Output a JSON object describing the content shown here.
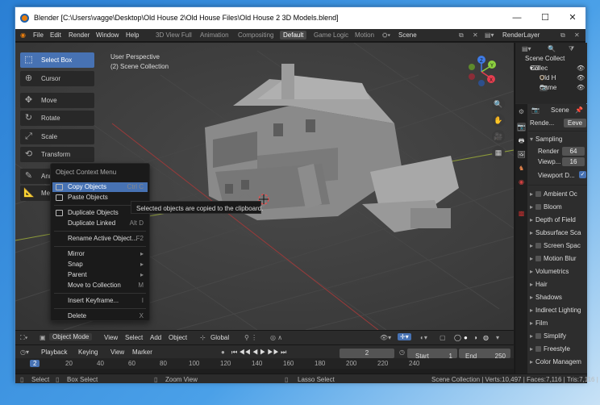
{
  "window": {
    "title": "Blender [C:\\Users\\vagge\\Desktop\\Old House 2\\Old House Files\\Old House 2 3D Models.blend]",
    "minimize": "—",
    "maximize": "☐",
    "close": "✕"
  },
  "menubar": {
    "menus": [
      "File",
      "Edit",
      "Render",
      "Window",
      "Help"
    ],
    "workspaces": [
      "3D View Full",
      "Animation",
      "Compositing",
      "Default",
      "Game Logic",
      "Motion"
    ],
    "active_workspace": "Default",
    "scene": "Scene",
    "render_layer": "RenderLayer"
  },
  "viewport": {
    "perspective": "User Perspective",
    "collection": "(2) Scene Collection",
    "gizmo_axes": [
      "Z",
      "Y",
      "X"
    ]
  },
  "toolbar": {
    "tools": [
      {
        "label": "Select Box",
        "icon": "select-box-icon"
      },
      {
        "label": "Cursor",
        "icon": "cursor-icon"
      },
      {
        "label": "Move",
        "icon": "move-icon"
      },
      {
        "label": "Rotate",
        "icon": "rotate-icon"
      },
      {
        "label": "Scale",
        "icon": "scale-icon"
      },
      {
        "label": "Transform",
        "icon": "transform-icon"
      },
      {
        "label": "Ann",
        "icon": "annotate-icon"
      },
      {
        "label": "Mea",
        "icon": "measure-icon"
      }
    ],
    "selected": "Select Box"
  },
  "context_menu": {
    "title": "Object Context Menu",
    "items": [
      {
        "label": "Copy Objects",
        "shortcut": "Ctrl C"
      },
      {
        "label": "Paste Objects",
        "shortcut": ""
      },
      {
        "label": "Duplicate Objects",
        "shortcut": ""
      },
      {
        "label": "Duplicate Linked",
        "shortcut": "Alt D"
      },
      {
        "label": "Rename Active Object...",
        "shortcut": "F2"
      },
      {
        "label": "Mirror",
        "shortcut": "▸"
      },
      {
        "label": "Snap",
        "shortcut": "▸"
      },
      {
        "label": "Parent",
        "shortcut": "▸"
      },
      {
        "label": "Move to Collection",
        "shortcut": "M"
      },
      {
        "label": "Insert Keyframe...",
        "shortcut": "I"
      },
      {
        "label": "Delete",
        "shortcut": "X"
      }
    ],
    "tooltip": "Selected objects are copied to the clipboard."
  },
  "viewport_header": {
    "mode": "Object Mode",
    "menus": [
      "View",
      "Select",
      "Add",
      "Object"
    ],
    "pivot": "Global"
  },
  "timeline": {
    "playback": "Playback",
    "keying": "Keying",
    "view": "View",
    "marker": "Marker",
    "current_frame": "2",
    "start_label": "Start",
    "start": "1",
    "end_label": "End",
    "end": "250",
    "ruler_ticks": [
      "2",
      "20",
      "40",
      "60",
      "80",
      "100",
      "120",
      "140",
      "160",
      "180",
      "200",
      "220",
      "240"
    ]
  },
  "statusbar": {
    "select": "Select",
    "box_select": "Box Select",
    "zoom_view": "Zoom View",
    "lasso_select": "Lasso Select",
    "stats": "Scene Collection | Verts:10,497 | Faces:7,116 | Tris:7,116 |"
  },
  "outliner": {
    "root": "Scene Collect",
    "items": [
      "Collec",
      "Old H",
      "Came"
    ]
  },
  "properties": {
    "scene_label": "Scene",
    "render_engine_label": "Rende...",
    "render_engine": "Eeve",
    "sampling": "Sampling",
    "render_samples_label": "Render",
    "render_samples": "64",
    "viewport_samples_label": "Viewp...",
    "viewport_samples": "16",
    "viewport_denoise": "Viewport D...",
    "panels": [
      "Ambient Oc",
      "Bloom",
      "Depth of Field",
      "Subsurface Sca",
      "Screen Spac",
      "Motion Blur",
      "Volumetrics",
      "Hair",
      "Shadows",
      "Indirect Lighting",
      "Film",
      "Simplify",
      "Freestyle",
      "Color Managem"
    ],
    "checkbox_panels": [
      "Ambient Oc",
      "Bloom",
      "Screen Spac",
      "Motion Blur",
      "Simplify",
      "Freestyle"
    ]
  },
  "colors": {
    "accent": "#4772b3",
    "x_axis": "#e53e4f",
    "y_axis": "#8ccf3f",
    "z_axis": "#3f7be5"
  }
}
